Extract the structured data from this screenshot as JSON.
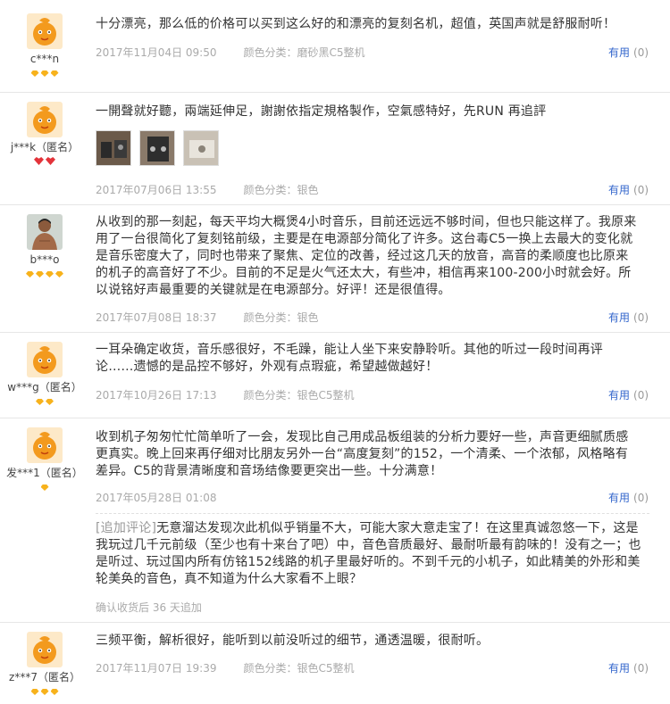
{
  "reviews": [
    {
      "user": "c***n",
      "avatar": "mascot-icon",
      "medal_count": 3,
      "content": "十分漂亮，那么低的价格可以买到这么好的和漂亮的复刻名机，超值，英国声就是舒服耐听！",
      "date": "2017年11月04日 09:50",
      "sku": "颜色分类：磨砂黑C5整机",
      "useful_label": "有用",
      "useful_count": "(0)"
    },
    {
      "user": "j***k（匿名）",
      "avatar": "mascot-icon",
      "medal_count": 2,
      "content": "一開聲就好聽，兩端延伸足，謝謝依指定規格製作，空氣感特好，先RUN 再追評",
      "date": "2017年07月06日 13:55",
      "sku": "颜色分类：银色",
      "useful_label": "有用",
      "useful_count": "(0)"
    },
    {
      "user": "b***o",
      "avatar": "photo-avatar",
      "medal_count": 4,
      "content": "从收到的那一刻起，每天平均大概煲4小时音乐，目前还远远不够时间，但也只能这样了。我原来用了一台很简化了复刻铭前级，主要是在电源部分简化了许多。这台毒C5一换上去最大的变化就是音乐密度大了，同时也带来了聚焦、定位的改善，经过这几天的放音，高音的柔顺度也比原来的机子的高音好了不少。目前的不足是火气还太大，有些冲，相信再来100-200小时就会好。所以说铭好声最重要的关键就是在电源部分。好评！还是很值得。",
      "date": "2017年07月08日 18:37",
      "sku": "颜色分类：银色",
      "useful_label": "有用",
      "useful_count": "(0)"
    },
    {
      "user": "w***g（匿名）",
      "avatar": "mascot-icon",
      "medal_count": 2,
      "content": "一耳朵确定收货，音乐感很好，不毛躁，能让人坐下来安静聆听。其他的听过一段时间再评论……遗憾的是品控不够好，外观有点瑕疵，希望越做越好！",
      "date": "2017年10月26日 17:13",
      "sku": "颜色分类：银色C5整机",
      "useful_label": "有用",
      "useful_count": "(0)"
    },
    {
      "user": "发***1（匿名）",
      "avatar": "mascot-icon",
      "medal_count": 1,
      "content": "收到机子匆匆忙忙简单听了一会，发现比自己用成品板组装的分析力要好一些，声音更细腻质感更真实。晚上回来再仔细对比朋友另外一台“高度复刻”的152，一个清柔、一个浓郁，风格略有差异。C5的背景清晰度和音场结像要更突出一些。十分满意！",
      "date": "2017年05月28日 01:08",
      "sku": "",
      "useful_label": "有用",
      "useful_count": "(0)",
      "followup_tag": "[追加评论]",
      "followup": "无意溜达发现次此机似乎销量不大，可能大家大意走宝了！在这里真诚忽悠一下，这是我玩过几千元前级（至少也有十来台了吧）中，音色音质最好、最耐听最有韵味的！没有之一；也是听过、玩过国内所有仿铭152线路的机子里最好听的。不到千元的小机子，如此精美的外形和美轮美奂的音色，真不知道为什么大家看不上眼？",
      "followup_meta": "确认收货后 36 天追加"
    },
    {
      "user": "z***7（匿名）",
      "avatar": "mascot-icon",
      "medal_count": 3,
      "content": "三频平衡，解析很好，能听到以前没听过的细节，通透温暖，很耐听。",
      "date": "2017年11月07日 19:39",
      "sku": "颜色分类：银色C5整机",
      "useful_label": "有用",
      "useful_count": "(0)"
    }
  ],
  "colors": {
    "mascot": "#f39a1e",
    "link": "#3366cc",
    "meta": "#aaaaaa"
  }
}
